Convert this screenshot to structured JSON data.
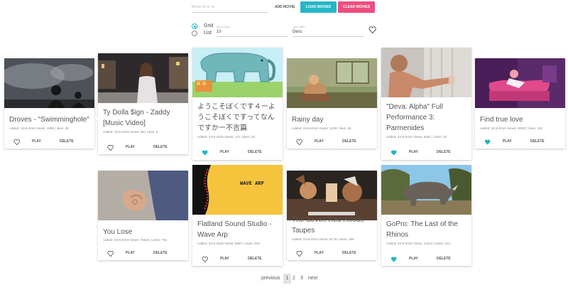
{
  "toolbar": {
    "url_placeholder": "Movie url or id",
    "add_label": "ADD MOVIE",
    "load_label": "LOAD MOVIES",
    "clear_label": "CLEAR MOVIES",
    "load_color": "#26b6c6",
    "clear_color": "#ee4d7f"
  },
  "view": {
    "grid_label": "Grid",
    "list_label": "List",
    "selected": "Grid",
    "item_count_label": "Item count",
    "item_count_value": "10",
    "sort_label": "Sort order",
    "sort_value": "Desc"
  },
  "labels": {
    "play": "PLAY",
    "delete": "DELETE"
  },
  "cards": [
    {
      "title": "Droves - \"Swimminghole\"",
      "meta": "Added: 23-8-2016 Views: 1695 | likes: 26",
      "favorite": false
    },
    {
      "title": "Ty Dolla $ign - Zaddy [Music Video]",
      "meta": "Added: 23-8-2016 Views: 28 | Likes: 4",
      "favorite": false
    },
    {
      "title": "ようこそぼくです４ーようこそぼくですってなんですかー不吉篇",
      "meta": "Added: 23-8-2016 Views: 137 | likes: 46",
      "favorite": true
    },
    {
      "title": "Rainy day",
      "meta": "Added: 23-8-2016 Views: 2229 | likes: 30",
      "favorite": false
    },
    {
      "title": "\"Deva: Alpha\" Full Performance 3: Parmenides",
      "meta": "Added: 23-8-2016 Views: 8081 | Likes: 25",
      "favorite": true
    },
    {
      "title": "Find true love",
      "meta": "Added: 23-8-2016 Views: 30057 | likes: 322",
      "favorite": true
    },
    {
      "title": "You Lose",
      "meta": "Added: 23-8-2016 Views: 75026 | Likes: 752",
      "favorite": false
    },
    {
      "title": "Flatland Sound Studio - Wave Arp",
      "meta": "Added: 23-8-2016 Views: 8667 | Likes: 228",
      "favorite": false
    },
    {
      "title": "The Seven Red Hoods - Taupes",
      "meta": "Added: 23-8-2016 Views: 5179 | Likes: 366",
      "favorite": false
    },
    {
      "title": "GoPro: The Last of the Rhinos",
      "meta": "Added: 23-8-2016 Views: 14113 | Likes: 213",
      "favorite": true
    }
  ],
  "thumb_texts": {
    "wave_arp": "WAVE ARP"
  },
  "pagination": {
    "previous": "previous",
    "pages": [
      "1",
      "2",
      "3"
    ],
    "current": "1",
    "next": "next"
  },
  "heart_color": "#26b6c6"
}
